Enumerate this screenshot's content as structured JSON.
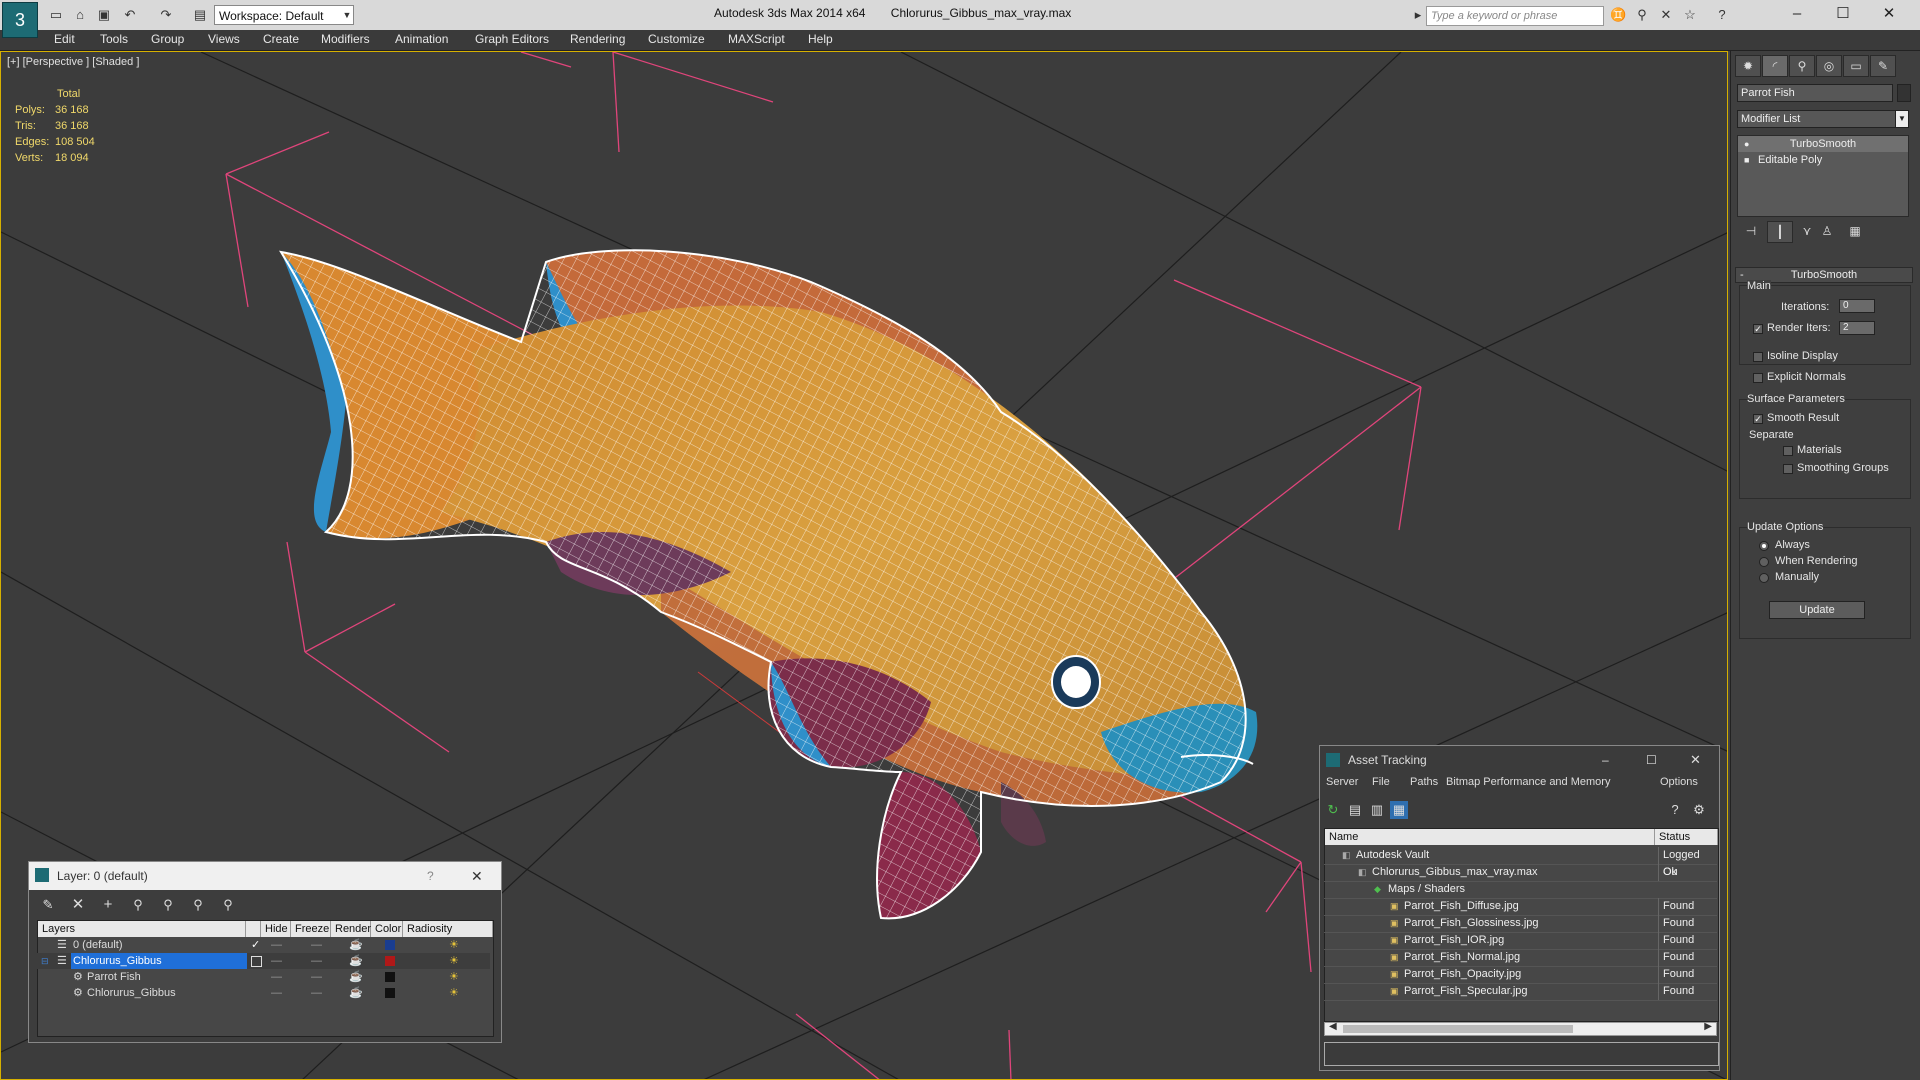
{
  "title_bar": {
    "workspace": "Workspace: Default",
    "app_title": "Autodesk 3ds Max  2014 x64",
    "file_name": "Chlorurus_Gibbus_max_vray.max",
    "search_placeholder": "Type a keyword or phrase"
  },
  "menu": [
    "Edit",
    "Tools",
    "Group",
    "Views",
    "Create",
    "Modifiers",
    "Animation",
    "Graph Editors",
    "Rendering",
    "Customize",
    "MAXScript",
    "Help"
  ],
  "viewport": {
    "label": "[+] [Perspective ] [Shaded ]",
    "stats_header": "Total",
    "stats": [
      {
        "label": "Polys:",
        "value": "36 168"
      },
      {
        "label": "Tris:",
        "value": "36 168"
      },
      {
        "label": "Edges:",
        "value": "108 504"
      },
      {
        "label": "Verts:",
        "value": "18 094"
      }
    ]
  },
  "command_panel": {
    "object_name": "Parrot Fish",
    "modifier_list": "Modifier List",
    "stack": [
      "TurboSmooth",
      "Editable Poly"
    ],
    "rollout_title": "TurboSmooth",
    "main_group": "Main",
    "iterations_label": "Iterations:",
    "iterations_value": "0",
    "render_iters_label": "Render Iters:",
    "render_iters_value": "2",
    "isoline_display": "Isoline Display",
    "explicit_normals": "Explicit Normals",
    "surface_params": "Surface Parameters",
    "smooth_result": "Smooth Result",
    "separate": "Separate",
    "materials": "Materials",
    "smoothing_groups": "Smoothing Groups",
    "update_options": "Update Options",
    "always": "Always",
    "when_rendering": "When Rendering",
    "manually": "Manually",
    "update_button": "Update"
  },
  "layer_dialog": {
    "title": "Layer: 0 (default)",
    "help": "?",
    "columns": [
      "Layers",
      "Hide",
      "Freeze",
      "Render",
      "Color",
      "Radiosity"
    ],
    "rows": [
      {
        "name": "0 (default)",
        "color": "#1a3d8f"
      },
      {
        "name": "Chlorurus_Gibbus",
        "color": "#b01818"
      },
      {
        "name": "Parrot Fish",
        "color": "#111111"
      },
      {
        "name": "Chlorurus_Gibbus",
        "color": "#111111"
      }
    ]
  },
  "asset_tracking": {
    "title": "Asset Tracking",
    "menu": [
      "Server",
      "File",
      "Paths",
      "Bitmap Performance and Memory",
      "Options"
    ],
    "columns": [
      "Name",
      "Status"
    ],
    "rows": [
      {
        "name": "Autodesk Vault",
        "status": "Logged Ou",
        "indent": 0
      },
      {
        "name": "Chlorurus_Gibbus_max_vray.max",
        "status": "Ok",
        "indent": 1
      },
      {
        "name": "Maps / Shaders",
        "status": "",
        "indent": 2
      },
      {
        "name": "Parrot_Fish_Diffuse.jpg",
        "status": "Found",
        "indent": 3
      },
      {
        "name": "Parrot_Fish_Glossiness.jpg",
        "status": "Found",
        "indent": 3
      },
      {
        "name": "Parrot_Fish_IOR.jpg",
        "status": "Found",
        "indent": 3
      },
      {
        "name": "Parrot_Fish_Normal.jpg",
        "status": "Found",
        "indent": 3
      },
      {
        "name": "Parrot_Fish_Opacity.jpg",
        "status": "Found",
        "indent": 3
      },
      {
        "name": "Parrot_Fish_Specular.jpg",
        "status": "Found",
        "indent": 3
      }
    ]
  }
}
